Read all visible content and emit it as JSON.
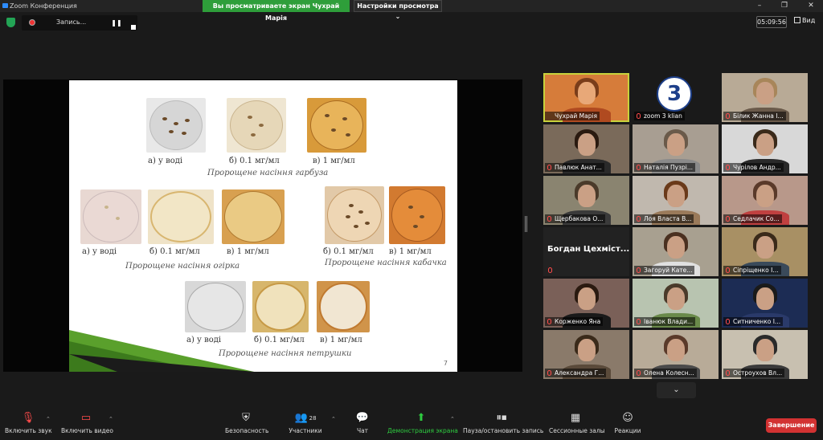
{
  "window": {
    "title": "Zoom Конференция",
    "share_banner": "Вы просматриваете экран Чухрай Марія",
    "view_options": "Настройки просмотра ⌄"
  },
  "topbar": {
    "recording_label": "Запись...",
    "timer": "05:09:56",
    "view_label": "Вид"
  },
  "slide": {
    "row1": {
      "caption_a": "а) у воді",
      "caption_b": "б) 0.1 мг/мл",
      "caption_c": "в) 1 мг/мл",
      "title": "Пророщене насіння гарбуза"
    },
    "row2": {
      "caption_a": "а) у воді",
      "caption_b": "б) 0.1 мг/мл",
      "caption_c": "в) 1 мг/мл",
      "title": "Пророщене насіння огірка"
    },
    "row2b": {
      "caption_b": "б) 0.1 мг/мл",
      "caption_c": "в) 1 мг/мл",
      "title": "Пророщене насіння кабачка"
    },
    "row3": {
      "caption_a": "а) у воді",
      "caption_b": "б) 0.1 мг/мл",
      "caption_c": "в) 1 мг/мл",
      "title": "Пророщене насіння петрушки"
    },
    "page_number": "7"
  },
  "gallery": {
    "tiles": [
      {
        "name": "Чухрай Марія"
      },
      {
        "name": "zoom 3 klian"
      },
      {
        "name": "Білик Жанна І..."
      },
      {
        "name": "Павлюк Анат..."
      },
      {
        "name": "Наталія Пузрі..."
      },
      {
        "name": "Чурілов Андр..."
      },
      {
        "name": "Щербакова О..."
      },
      {
        "name": "Лоя Власта В..."
      },
      {
        "name": "Седлачик Со..."
      },
      {
        "name": "Богдан Цехміст..."
      },
      {
        "name": "Загоруй Кате..."
      },
      {
        "name": "Сіпріщенко І..."
      },
      {
        "name": "Корженко Яна"
      },
      {
        "name": "Іванюк Влади..."
      },
      {
        "name": "Ситниченко І..."
      },
      {
        "name": "Александра Г..."
      },
      {
        "name": "Олена Колесн..."
      },
      {
        "name": "Остроухов Вл..."
      }
    ]
  },
  "toolbar": {
    "unmute": "Включить звук",
    "start_video": "Включить видео",
    "security": "Безопасность",
    "participants": "Участники",
    "participants_count": "28",
    "chat": "Чат",
    "share_screen": "Демонстрация экрана",
    "pause_record": "Пауза/остановить запись",
    "breakout": "Сессионные залы",
    "reactions": "Реакции",
    "end": "Завершение"
  },
  "colors": {
    "share_banner": "#2e9e3a",
    "active_speaker": "#c8d23c",
    "end_button": "#d23232",
    "share_button": "#2ecc40"
  }
}
